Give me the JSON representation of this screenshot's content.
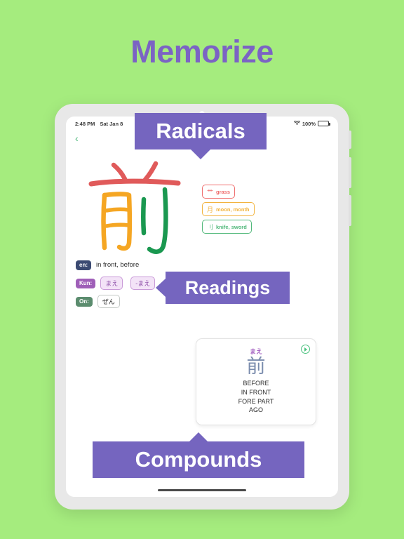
{
  "page": {
    "headline": "Memorize",
    "background_color": "#a5ec7e",
    "accent_color": "#7565bf"
  },
  "device": {
    "statusbar": {
      "time": "2:48 PM",
      "date": "Sat Jan 8",
      "wifi_icon": "wifi-icon",
      "battery_percent": "100%",
      "battery_icon": "battery-full-icon"
    },
    "back_icon": "chevron-left-icon",
    "home_indicator": "home-indicator"
  },
  "kanji": {
    "character": "前",
    "stroke_colors": {
      "top": "#e05a5a",
      "moon": "#f5a623",
      "knife": "#1a9850"
    }
  },
  "radicals": {
    "items": [
      {
        "glyph": "艹",
        "label": "grass",
        "color": "#ef6f6f",
        "name": "radical-grass"
      },
      {
        "glyph": "月",
        "label": "moon, month",
        "color": "#f2b33d",
        "name": "radical-moon"
      },
      {
        "glyph": "刂",
        "label": "knife, sword",
        "color": "#51b87a",
        "name": "radical-knife"
      }
    ]
  },
  "readings": {
    "en": {
      "label": "en:",
      "value": "in front, before",
      "color": "#3b4a72"
    },
    "kun": {
      "label": "Kun:",
      "chips": [
        "まえ",
        "-まえ"
      ],
      "color": "#9f5fb8"
    },
    "on": {
      "label": "On:",
      "chips": [
        "ぜん"
      ],
      "color": "#5b8c6e"
    }
  },
  "compound_card": {
    "furigana": "まえ",
    "kanji": "前",
    "meanings": [
      "BEFORE",
      "IN FRONT",
      "FORE PART",
      "AGO"
    ],
    "play_icon": "play-circle-icon"
  },
  "callouts": {
    "radicals": "Radicals",
    "readings": "Readings",
    "compounds": "Compounds"
  }
}
